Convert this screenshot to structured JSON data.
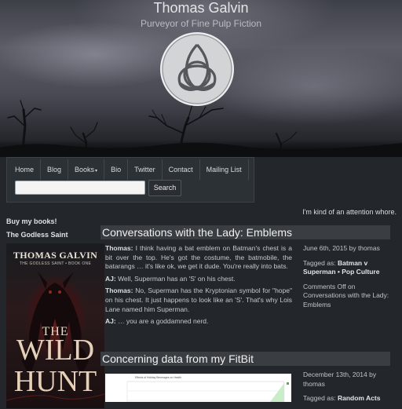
{
  "site": {
    "title": "Thomas Galvin",
    "tagline": "Purveyor of Fine Pulp Fiction"
  },
  "nav": {
    "items": [
      {
        "label": "Home"
      },
      {
        "label": "Blog"
      },
      {
        "label": "Books",
        "has_dropdown": true
      },
      {
        "label": "Bio"
      },
      {
        "label": "Twitter"
      },
      {
        "label": "Contact"
      },
      {
        "label": "Mailing List"
      }
    ],
    "caret": "▾",
    "search_placeholder": "",
    "search_button": "Search"
  },
  "attention_text": "I'm kind of an attention whore.",
  "sidebar": {
    "buy_heading": "Buy my books!",
    "book_heading": "The Godless Saint",
    "cover": {
      "author": "THOMAS GALVIN",
      "series": "THE GODLESS SAINT • BOOK ONE",
      "the": "THE",
      "title_line1": "WILD",
      "title_line2": "HUNT"
    }
  },
  "posts": [
    {
      "title": "Conversations with the Lady: Emblems",
      "body": [
        {
          "speaker": "Thomas:",
          "text": " I think having a bat emblem on Batman's chest is a bit over the top. He's got the costume, the batmobile, the batarangs … it's like ok, we get it dude. You're really into bats."
        },
        {
          "speaker": "AJ:",
          "text": " Well, Superman has an 'S' on his chest."
        },
        {
          "speaker": "Thomas:",
          "text": " No, Superman has the Kryptonian symbol for \"hope\" on his chest. It just happens to look like an 'S'. That's why Lois Lane named him Superman."
        },
        {
          "speaker": "AJ:",
          "text": " … you are a goddamned nerd."
        }
      ],
      "meta": {
        "date_line": "June 6th, 2015 by thomas",
        "tagged_prefix": "Tagged as: ",
        "tags": "Batman v Superman • Pop Culture",
        "comments": "Comments Off on Conversations with the Lady: Emblems"
      }
    },
    {
      "title": "Concerning data from my FitBit",
      "chart_title": "Effects of Holiday Beverages on Health",
      "meta": {
        "date_line": "December 13th, 2014 by thomas",
        "tagged_prefix": "Tagged as: ",
        "tags": "Random Acts"
      }
    }
  ],
  "colors": {
    "page_bg": "#23272b",
    "nav_bg": "#2c3135",
    "title_bar_bg": "#3a3e42",
    "chart_line": "#4caf50"
  },
  "icons": {
    "logo": "triquetra-icon",
    "caret": "chevron-down-icon"
  }
}
